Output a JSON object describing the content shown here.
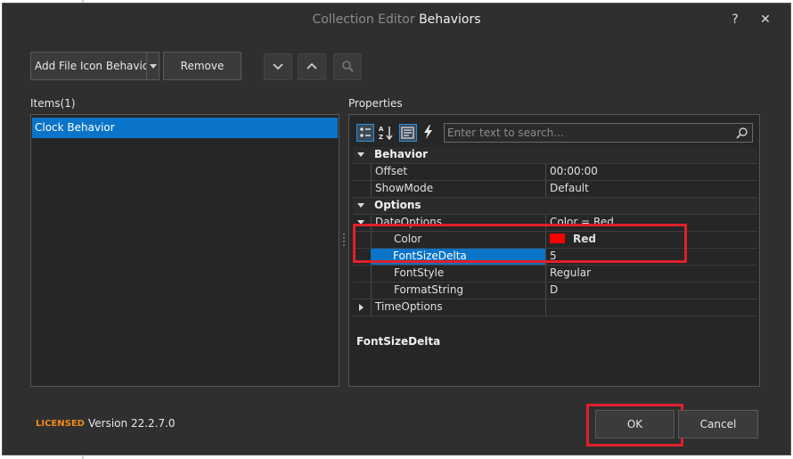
{
  "dialog": {
    "title_prefix": "Collection Editor",
    "title_name": "Behaviors",
    "help_label": "?",
    "close_label": "✕"
  },
  "toolbar": {
    "add_label": "Add File Icon Behavior",
    "remove_label": "Remove",
    "move_down_icon": "chevron-down-icon",
    "move_up_icon": "chevron-up-icon",
    "find_icon": "search-icon"
  },
  "items": {
    "header": "Items(1)",
    "list": [
      "Clock Behavior"
    ]
  },
  "properties": {
    "header": "Properties",
    "search_placeholder": "Enter text to search...",
    "rows": {
      "behavior_cat": "Behavior",
      "offset_name": "Offset",
      "offset_value": "00:00:00",
      "showmode_name": "ShowMode",
      "showmode_value": "Default",
      "options_cat": "Options",
      "dateoptions_name": "DateOptions",
      "dateoptions_value": "Color = Red",
      "color_name": "Color",
      "color_value": "Red",
      "color_hex": "#ff0000",
      "fontsizedelta_name": "FontSizeDelta",
      "fontsizedelta_value": "5",
      "fontstyle_name": "FontStyle",
      "fontstyle_value": "Regular",
      "formatstring_name": "FormatString",
      "formatstring_value": "D",
      "timeoptions_name": "TimeOptions",
      "timeoptions_value": ""
    },
    "description_title": "FontSizeDelta"
  },
  "footer": {
    "licensed": "LICENSED",
    "version": "Version 22.2.7.0",
    "ok_label": "OK",
    "cancel_label": "Cancel"
  },
  "colors": {
    "background": "#2f2f2f",
    "selection": "#0a74c8",
    "highlight": "#e0202a",
    "licensed": "#f08a1e"
  }
}
